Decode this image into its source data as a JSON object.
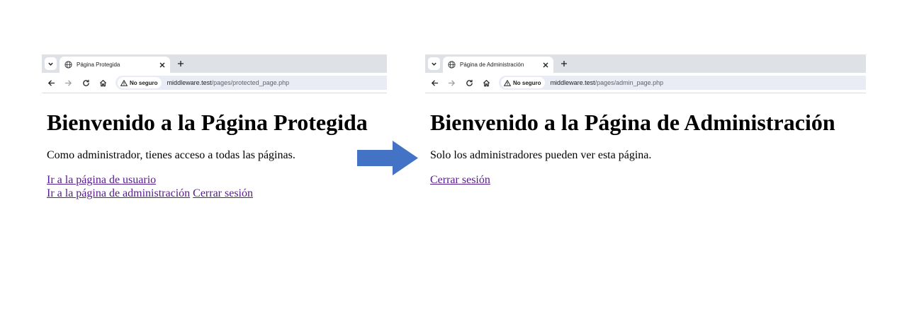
{
  "left_browser": {
    "tab_title": "Página Protegida",
    "security_chip": "No seguro",
    "url_host": "middleware.test",
    "url_path": "/pages/protected_page.php",
    "heading": "Bienvenido a la Página Protegida",
    "paragraph": "Como administrador, tienes acceso a todas las páginas.",
    "links": {
      "user_page": "Ir a la página de usuario",
      "admin_page": "Ir a la página de administración",
      "logout": "Cerrar sesión"
    }
  },
  "right_browser": {
    "tab_title": "Página de Administración",
    "security_chip": "No seguro",
    "url_host": "middleware.test",
    "url_path": "/pages/admin_page.php",
    "heading": "Bienvenido a la Página de Administración",
    "paragraph": "Solo los administradores pueden ver esta página.",
    "links": {
      "logout": "Cerrar sesión"
    }
  },
  "colors": {
    "tabbar": "#dee1e6",
    "omnibox": "#e9ecf4",
    "visited_link": "#551a8b",
    "arrow": "#4472c4"
  },
  "icons": [
    "chevron-down-icon",
    "globe-icon",
    "close-icon",
    "plus-icon",
    "back-arrow-icon",
    "forward-arrow-icon",
    "reload-icon",
    "home-icon",
    "warning-triangle-icon",
    "right-arrow-icon"
  ]
}
